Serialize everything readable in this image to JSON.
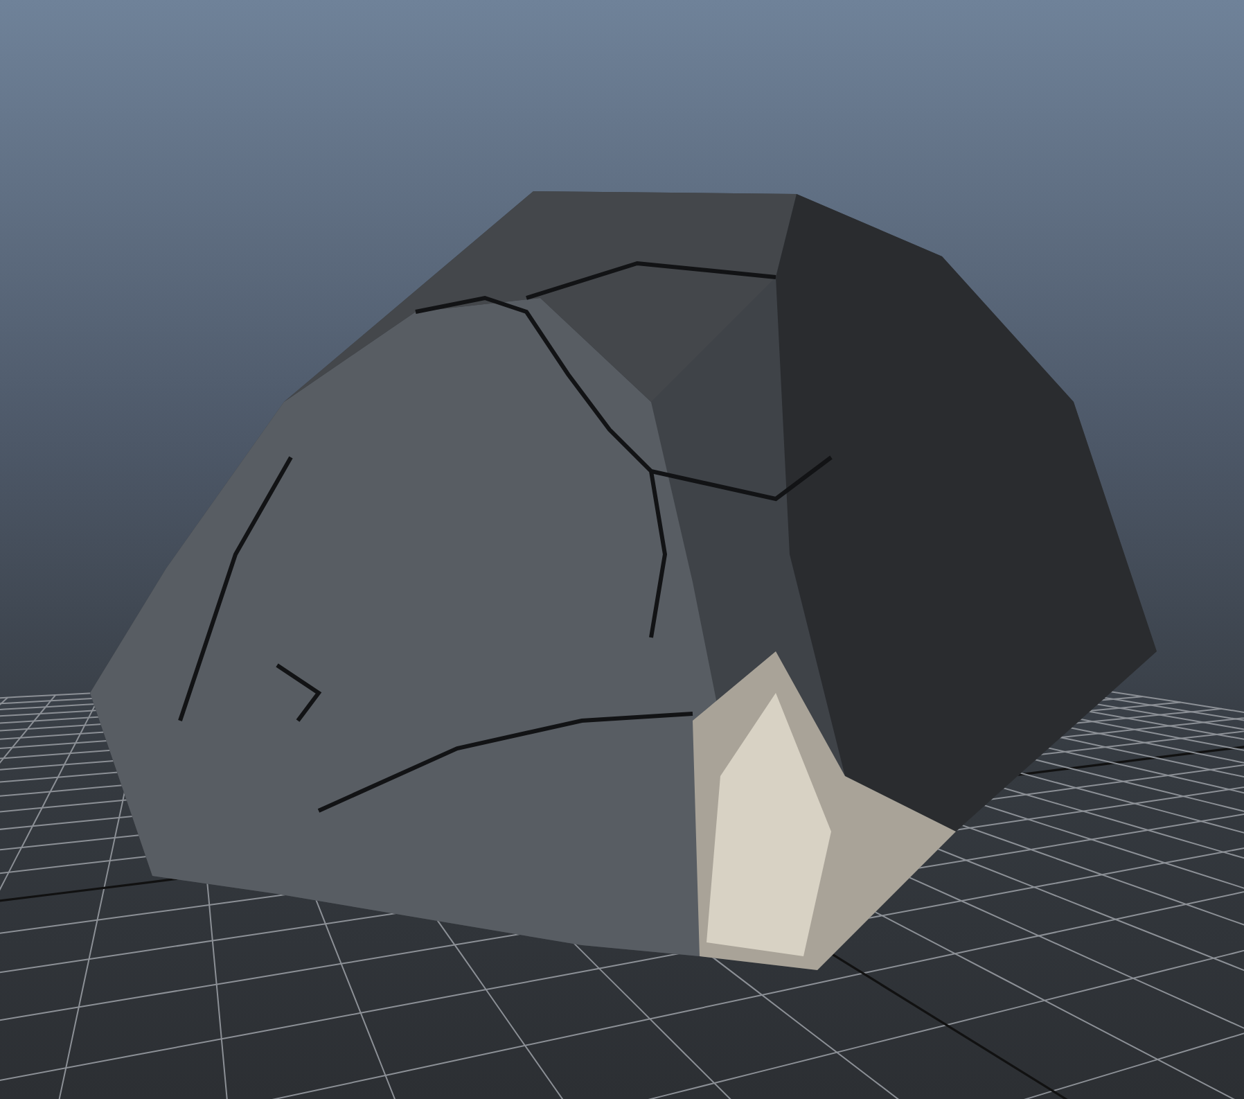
{
  "viewport": {
    "grid": true,
    "object": {
      "kind": "rock"
    }
  }
}
